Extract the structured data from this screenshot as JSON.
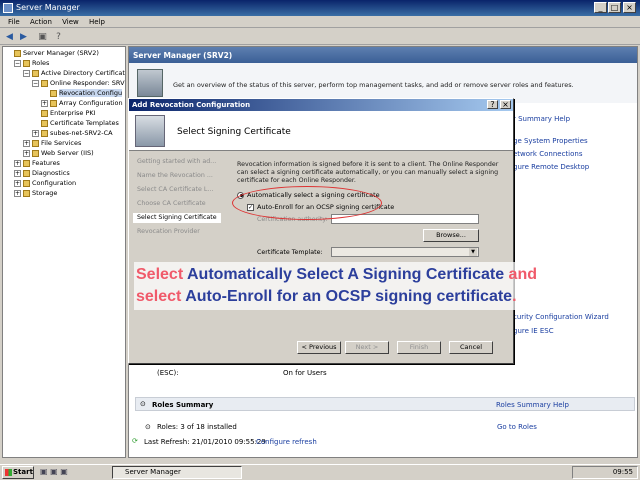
{
  "window": {
    "title": "Server Manager",
    "controls": [
      "_",
      "□",
      "×"
    ]
  },
  "menu": [
    "File",
    "Action",
    "View",
    "Help"
  ],
  "tree": [
    {
      "label": "Server Manager (SRV2)",
      "depth": 0,
      "toggle": ""
    },
    {
      "label": "Roles",
      "depth": 1,
      "toggle": "−"
    },
    {
      "label": "Active Directory Certificate",
      "depth": 2,
      "toggle": "−"
    },
    {
      "label": "Online Responder: SRV",
      "depth": 3,
      "toggle": "−"
    },
    {
      "label": "Revocation Configu",
      "depth": 4,
      "toggle": "",
      "selected": true
    },
    {
      "label": "Array Configuration",
      "depth": 4,
      "toggle": "+"
    },
    {
      "label": "Enterprise PKI",
      "depth": 3,
      "toggle": ""
    },
    {
      "label": "Certificate Templates",
      "depth": 3,
      "toggle": ""
    },
    {
      "label": "subes-net-SRV2-CA",
      "depth": 3,
      "toggle": "+"
    },
    {
      "label": "File Services",
      "depth": 2,
      "toggle": "+"
    },
    {
      "label": "Web Server (IIS)",
      "depth": 2,
      "toggle": "+"
    },
    {
      "label": "Features",
      "depth": 1,
      "toggle": "+"
    },
    {
      "label": "Diagnostics",
      "depth": 1,
      "toggle": "+"
    },
    {
      "label": "Configuration",
      "depth": 1,
      "toggle": "+"
    },
    {
      "label": "Storage",
      "depth": 1,
      "toggle": "+"
    }
  ],
  "right": {
    "header": "Server Manager (SRV2)",
    "banner": "Get an overview of the status of this server, perform top management tasks, and add or remove server roles and features.",
    "links": [
      "r Summary Help",
      "ge System Properties",
      "etwork Connections",
      "gure Remote Desktop"
    ],
    "links2": [
      "curity Configuration Wizard",
      "gure IE ESC"
    ],
    "esc_label": "(ESC):",
    "esc_value": "On for Users",
    "roles_summary": "Roles Summary",
    "roles_summary_help": "Roles Summary Help",
    "roles_count": "Roles: 3 of 18 installed",
    "goto_roles": "Go to Roles",
    "last_refresh": "Last Refresh: 21/01/2010 09:55:29",
    "configure_refresh": "Configure refresh"
  },
  "wizard": {
    "title": "Add Revocation Configuration",
    "title_buttons": [
      "?",
      "×"
    ],
    "heading": "Select Signing Certificate",
    "steps": [
      {
        "label": "Getting started with ad...",
        "current": false
      },
      {
        "label": "Name the Revocation ...",
        "current": false
      },
      {
        "label": "Select CA Certificate L...",
        "current": false
      },
      {
        "label": "Choose CA Certificate",
        "current": false
      },
      {
        "label": "Select Signing Certificate",
        "current": true
      },
      {
        "label": "Revocation Provider",
        "current": false
      }
    ],
    "description": "Revocation information is signed before it is sent to a client. The Online Responder can select a signing certificate automatically, or you can manually select a signing certificate for each Online Responder.",
    "auto_select": "Automatically select a signing certificate",
    "auto_enroll": "Auto-Enroll for an OCSP signing certificate",
    "ca_label": "Certification authority:",
    "browse": "Browse...",
    "template_label": "Certificate Template:",
    "buttons": {
      "previous": "< Previous",
      "next": "Next >",
      "finish": "Finish",
      "cancel": "Cancel"
    }
  },
  "caption": {
    "l1a": "Select ",
    "l1b": "Automatically Select A Signing Certificate",
    "l1c": " and",
    "l2a": "select ",
    "l2b": "Auto-Enroll for an OCSP signing certificate",
    "l2c": "."
  },
  "taskbar": {
    "start": "Start",
    "task": "Server Manager",
    "clock": "09:55"
  }
}
